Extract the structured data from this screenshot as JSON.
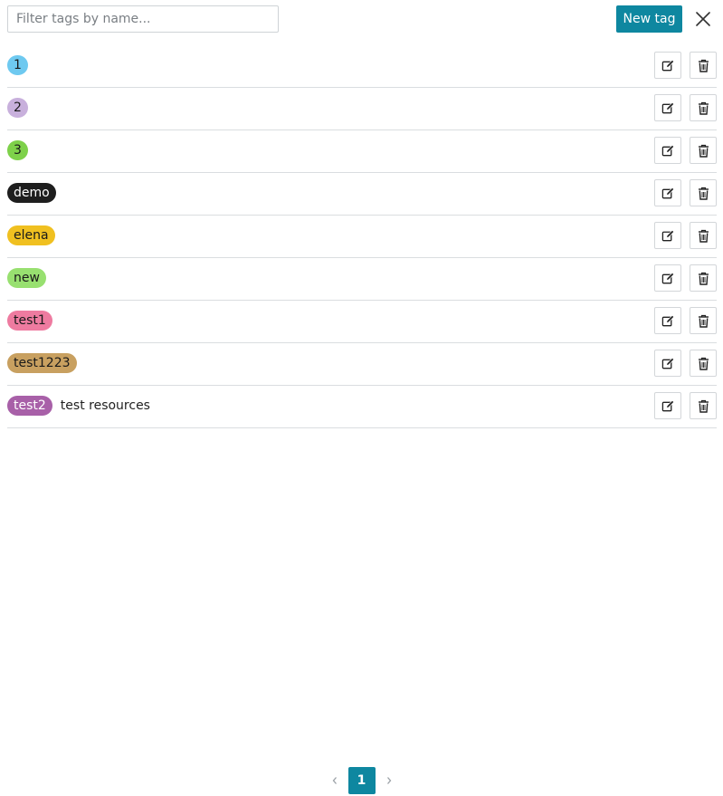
{
  "filter": {
    "placeholder": "Filter tags by name...",
    "value": ""
  },
  "toolbar": {
    "new_tag_label": "New tag",
    "close_icon": "close-icon"
  },
  "tags": [
    {
      "name": "1",
      "color": "#6ec9f0",
      "text_color": "#1a1a1a",
      "description": ""
    },
    {
      "name": "2",
      "color": "#c8b0dc",
      "text_color": "#1a1a1a",
      "description": ""
    },
    {
      "name": "3",
      "color": "#7ed14a",
      "text_color": "#1a1a1a",
      "description": ""
    },
    {
      "name": "demo",
      "color": "#1e1e1e",
      "text_color": "#ffffff",
      "description": ""
    },
    {
      "name": "elena",
      "color": "#f0c020",
      "text_color": "#1a1a1a",
      "description": ""
    },
    {
      "name": "new",
      "color": "#98e070",
      "text_color": "#1a1a1a",
      "description": ""
    },
    {
      "name": "test1",
      "color": "#ee7ba0",
      "text_color": "#1a1a1a",
      "description": ""
    },
    {
      "name": "test1223",
      "color": "#c8a060",
      "text_color": "#1a1a1a",
      "description": ""
    },
    {
      "name": "test2",
      "color": "#a860a8",
      "text_color": "#ffffff",
      "description": "test resources"
    }
  ],
  "row_actions": {
    "edit_icon": "edit-icon",
    "delete_icon": "trash-icon"
  },
  "pagination": {
    "current_page": "1",
    "prev_icon": "chevron-left-icon",
    "next_icon": "chevron-right-icon",
    "active_color": "#0e87a0"
  }
}
